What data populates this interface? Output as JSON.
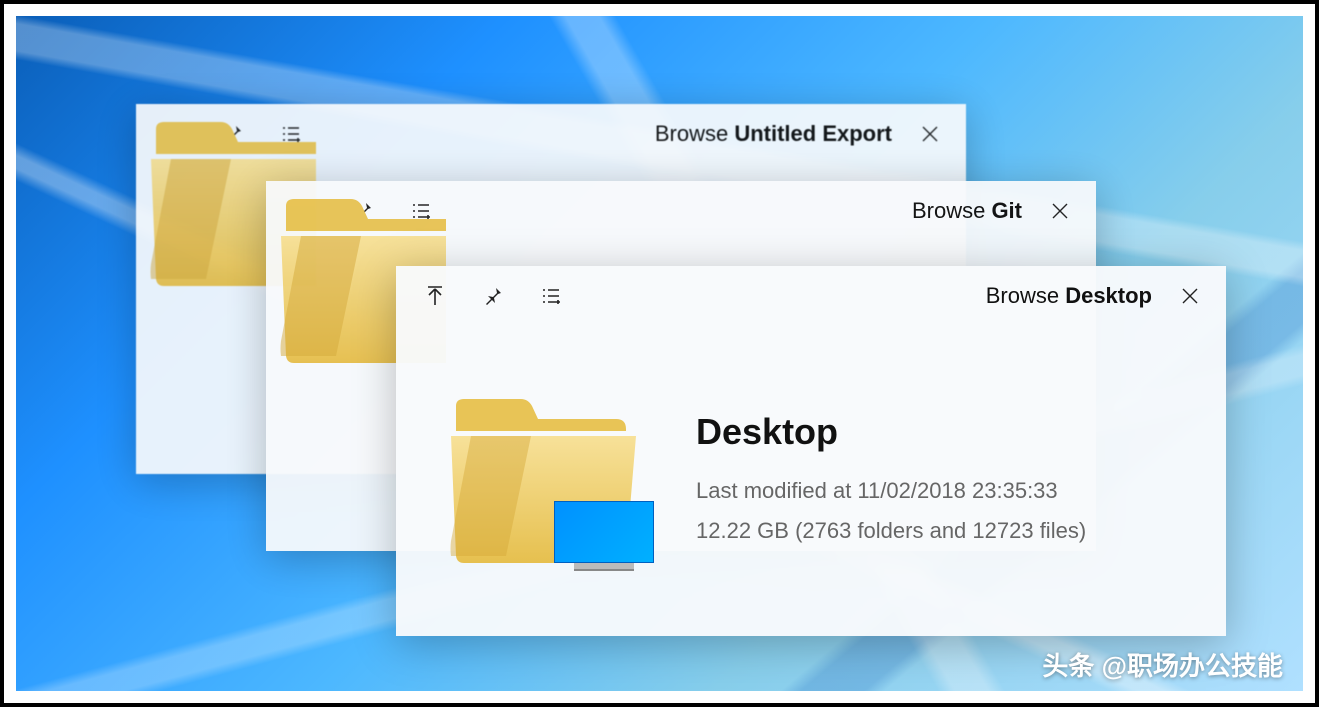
{
  "windows": [
    {
      "browse_prefix": "Browse ",
      "browse_target": "Untitled Export",
      "title": "Untitled Export",
      "modified": "",
      "stats": ""
    },
    {
      "browse_prefix": "Browse ",
      "browse_target": "Git",
      "title": "Git",
      "modified": "",
      "stats": ""
    },
    {
      "browse_prefix": "Browse ",
      "browse_target": "Desktop",
      "title": "Desktop",
      "modified": "Last modified at 11/02/2018 23:35:33",
      "stats": "12.22 GB (2763 folders and 12723 files)"
    }
  ],
  "watermark": "头条 @职场办公技能"
}
